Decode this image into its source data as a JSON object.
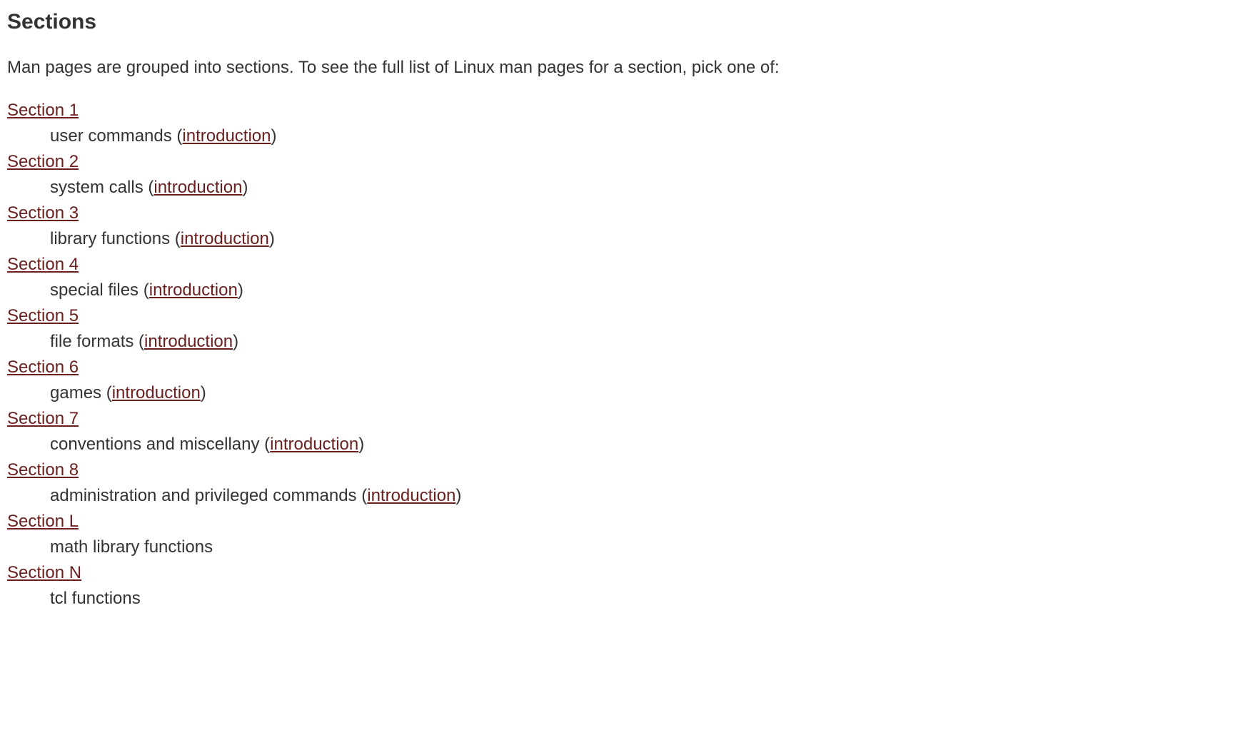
{
  "heading": "Sections",
  "intro": "Man pages are grouped into sections. To see the full list of Linux man pages for a section, pick one of:",
  "sections": [
    {
      "title": "Section 1",
      "desc": "user commands",
      "has_intro": true,
      "intro_label": "introduction"
    },
    {
      "title": "Section 2",
      "desc": "system calls",
      "has_intro": true,
      "intro_label": "introduction"
    },
    {
      "title": "Section 3",
      "desc": "library functions",
      "has_intro": true,
      "intro_label": "introduction"
    },
    {
      "title": "Section 4",
      "desc": "special files",
      "has_intro": true,
      "intro_label": "introduction"
    },
    {
      "title": "Section 5",
      "desc": "file formats",
      "has_intro": true,
      "intro_label": "introduction"
    },
    {
      "title": "Section 6",
      "desc": "games",
      "has_intro": true,
      "intro_label": "introduction"
    },
    {
      "title": "Section 7",
      "desc": "conventions and miscellany",
      "has_intro": true,
      "intro_label": "introduction"
    },
    {
      "title": "Section 8",
      "desc": "administration and privileged commands",
      "has_intro": true,
      "intro_label": "introduction"
    },
    {
      "title": "Section L",
      "desc": "math library functions",
      "has_intro": false
    },
    {
      "title": "Section N",
      "desc": "tcl functions",
      "has_intro": false
    }
  ]
}
